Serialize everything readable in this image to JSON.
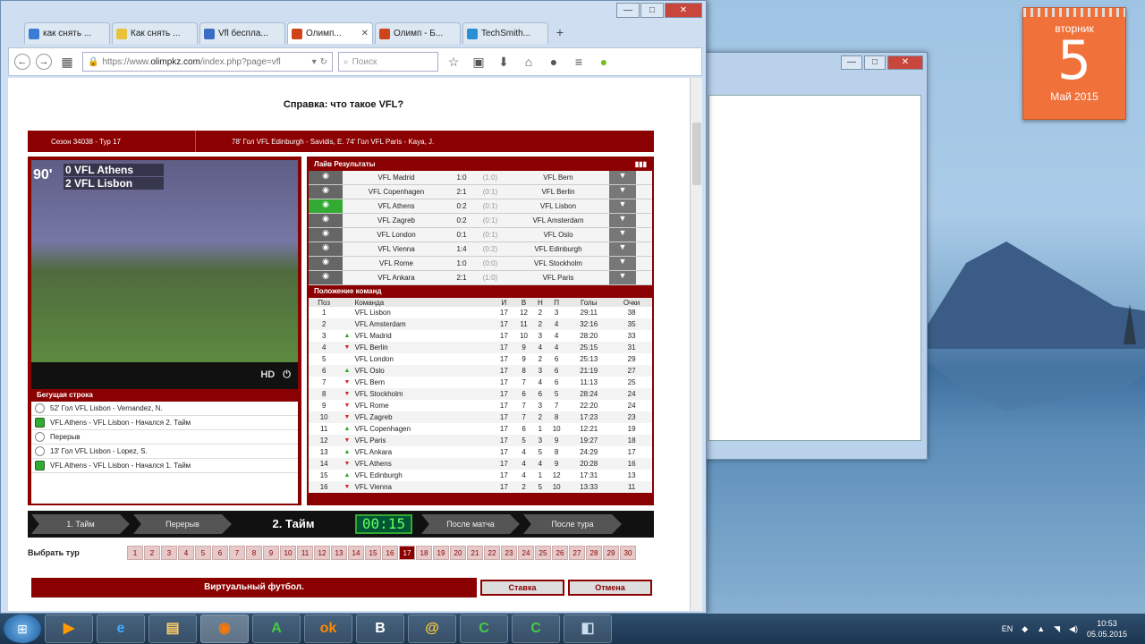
{
  "calendar": {
    "weekday": "вторник",
    "day": "5",
    "month": "Май 2015"
  },
  "browser": {
    "tabs": [
      {
        "label": "как снять ...",
        "color": "#3a7bd5"
      },
      {
        "label": "Как снять ...",
        "color": "#e8c23a"
      },
      {
        "label": "Vfl бесплa...",
        "color": "#3a6bc5"
      },
      {
        "label": "Олимп...",
        "color": "#d0441a",
        "active": true
      },
      {
        "label": "Олимп - Б...",
        "color": "#d0441a"
      },
      {
        "label": "TechSmith...",
        "color": "#2a8ed5"
      }
    ],
    "new_tab": "+",
    "url_host": "https://www.",
    "url_domain": "olimpkz.com",
    "url_path": "/index.php?page=vfl",
    "search_placeholder": "Поиск"
  },
  "page": {
    "title": "Справка: что такое VFL?",
    "season": "Сезон 34038 - Тур 17",
    "events": "78' Гол VFL Edinburgh - Savidis, E.      74' Гол VFL Paris - Kaya, J.",
    "video": {
      "minute": "90'",
      "home": "VFL Athens",
      "home_score": "0",
      "away": "VFL Lisbon",
      "away_score": "2",
      "hd": "HD"
    },
    "ticker_title": "Бегущая строка",
    "ticker": [
      {
        "text": "52' Гол VFL Lisbon - Vernandez, N.",
        "icon": "ball"
      },
      {
        "text": "VFL Athens - VFL Lisbon - Начался 2. Тайм",
        "icon": "pitch"
      },
      {
        "text": "Перерыв",
        "icon": "pause"
      },
      {
        "text": "13' Гол VFL Lisbon - Lopez, S.",
        "icon": "ball"
      },
      {
        "text": "VFL Athens - VFL Lisbon - Начался 1. Тайм",
        "icon": "pitch"
      }
    ],
    "live_title": "Лайв Результаты",
    "matches": [
      {
        "home": "VFL Madrid",
        "score": "1:0",
        "ht": "(1:0)",
        "away": "VFL Bern"
      },
      {
        "home": "VFL Copenhagen",
        "score": "2:1",
        "ht": "(0:1)",
        "away": "VFL Berlin"
      },
      {
        "home": "VFL Athens",
        "score": "0:2",
        "ht": "(0:1)",
        "away": "VFL Lisbon",
        "active": true
      },
      {
        "home": "VFL Zagreb",
        "score": "0:2",
        "ht": "(0:1)",
        "away": "VFL Amsterdam"
      },
      {
        "home": "VFL London",
        "score": "0:1",
        "ht": "(0:1)",
        "away": "VFL Oslo"
      },
      {
        "home": "VFL Vienna",
        "score": "1:4",
        "ht": "(0:2)",
        "away": "VFL Edinburgh"
      },
      {
        "home": "VFL Rome",
        "score": "1:0",
        "ht": "(0:0)",
        "away": "VFL Stockholm"
      },
      {
        "home": "VFL Ankara",
        "score": "2:1",
        "ht": "(1:0)",
        "away": "VFL Paris"
      }
    ],
    "standings_title": "Положение команд",
    "standings_headers": [
      "Поз",
      "",
      "Команда",
      "И",
      "В",
      "Н",
      "П",
      "Голы",
      "Очки"
    ],
    "standings": [
      [
        "1",
        "",
        "VFL Lisbon",
        "17",
        "12",
        "2",
        "3",
        "29:11",
        "38"
      ],
      [
        "2",
        "",
        "VFL Amsterdam",
        "17",
        "11",
        "2",
        "4",
        "32:16",
        "35"
      ],
      [
        "3",
        "up",
        "VFL Madrid",
        "17",
        "10",
        "3",
        "4",
        "28:20",
        "33"
      ],
      [
        "4",
        "dn",
        "VFL Berlin",
        "17",
        "9",
        "4",
        "4",
        "25:15",
        "31"
      ],
      [
        "5",
        "",
        "VFL London",
        "17",
        "9",
        "2",
        "6",
        "25:13",
        "29"
      ],
      [
        "6",
        "up",
        "VFL Oslo",
        "17",
        "8",
        "3",
        "6",
        "21:19",
        "27"
      ],
      [
        "7",
        "dn",
        "VFL Bern",
        "17",
        "7",
        "4",
        "6",
        "11:13",
        "25"
      ],
      [
        "8",
        "dn",
        "VFL Stockholm",
        "17",
        "6",
        "6",
        "5",
        "28:24",
        "24"
      ],
      [
        "9",
        "dn",
        "VFL Rome",
        "17",
        "7",
        "3",
        "7",
        "22:20",
        "24"
      ],
      [
        "10",
        "dn",
        "VFL Zagreb",
        "17",
        "7",
        "2",
        "8",
        "17:23",
        "23"
      ],
      [
        "11",
        "up",
        "VFL Copenhagen",
        "17",
        "6",
        "1",
        "10",
        "12:21",
        "19"
      ],
      [
        "12",
        "dn",
        "VFL Paris",
        "17",
        "5",
        "3",
        "9",
        "19:27",
        "18"
      ],
      [
        "13",
        "up",
        "VFL Ankara",
        "17",
        "4",
        "5",
        "8",
        "24:29",
        "17"
      ],
      [
        "14",
        "dn",
        "VFL Athens",
        "17",
        "4",
        "4",
        "9",
        "20:28",
        "16"
      ],
      [
        "15",
        "up",
        "VFL Edinburgh",
        "17",
        "4",
        "1",
        "12",
        "17:31",
        "13"
      ],
      [
        "16",
        "dn",
        "VFL Vienna",
        "17",
        "2",
        "5",
        "10",
        "13:33",
        "11"
      ]
    ],
    "phases": [
      "1. Тайм",
      "Перерыв",
      "2. Тайм",
      "00:15",
      "После матча",
      "После тура"
    ],
    "round_label": "Выбрать тур",
    "rounds": [
      "1",
      "2",
      "3",
      "4",
      "5",
      "6",
      "7",
      "8",
      "9",
      "10",
      "11",
      "12",
      "13",
      "14",
      "15",
      "16",
      "17",
      "18",
      "19",
      "20",
      "21",
      "22",
      "23",
      "24",
      "25",
      "26",
      "27",
      "28",
      "29",
      "30"
    ],
    "selected_round": "17",
    "bet_title": "Виртуальный футбол.",
    "bet_button": "Ставка",
    "cancel_button": "Отмена"
  },
  "tray": {
    "lang": "EN",
    "time": "10:53",
    "date": "05.05.2015"
  }
}
